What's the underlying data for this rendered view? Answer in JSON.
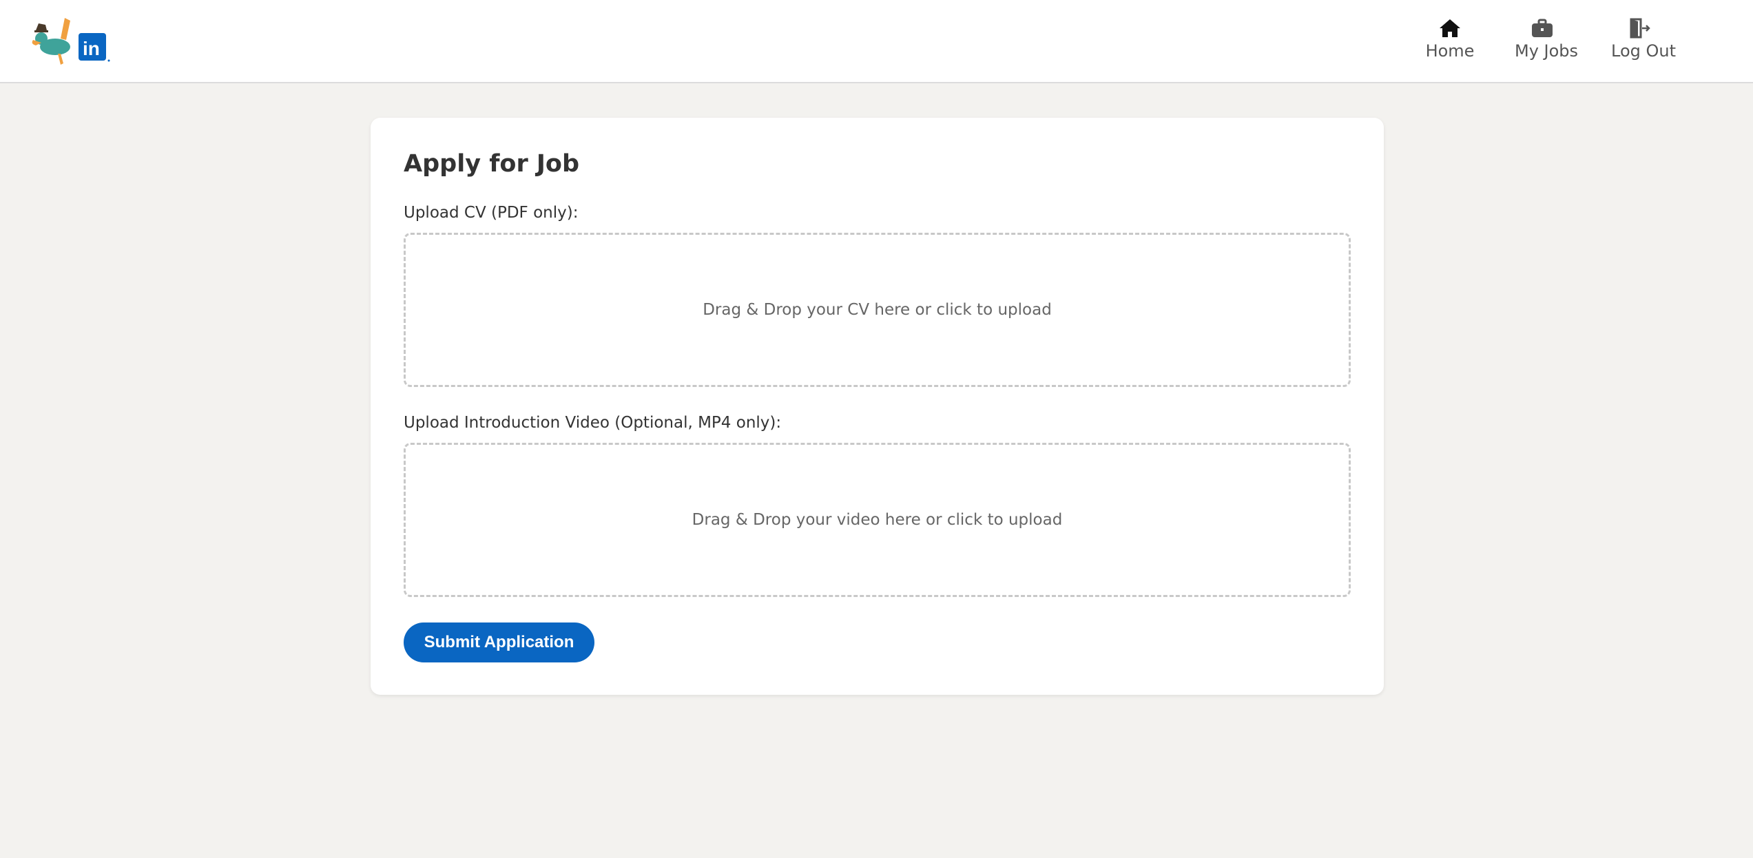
{
  "nav": {
    "logo": {
      "icon": "agent-platypus-linkedin-logo",
      "text": "in"
    },
    "items": [
      {
        "label": "Home",
        "icon": "home-icon"
      },
      {
        "label": "My Jobs",
        "icon": "briefcase-icon"
      },
      {
        "label": "Log Out",
        "icon": "logout-door-icon"
      }
    ]
  },
  "form": {
    "title": "Apply for Job",
    "cv_label": "Upload CV (PDF only):",
    "cv_dropzone_text": "Drag & Drop your CV here or click to upload",
    "video_label": "Upload Introduction Video (Optional, MP4 only):",
    "video_dropzone_text": "Drag & Drop your video here or click to upload",
    "submit_label": "Submit Application"
  },
  "colors": {
    "primary": "#0a66c2",
    "background": "#f3f2ef",
    "card": "#ffffff",
    "dropzone_border": "#c8c8c8"
  }
}
